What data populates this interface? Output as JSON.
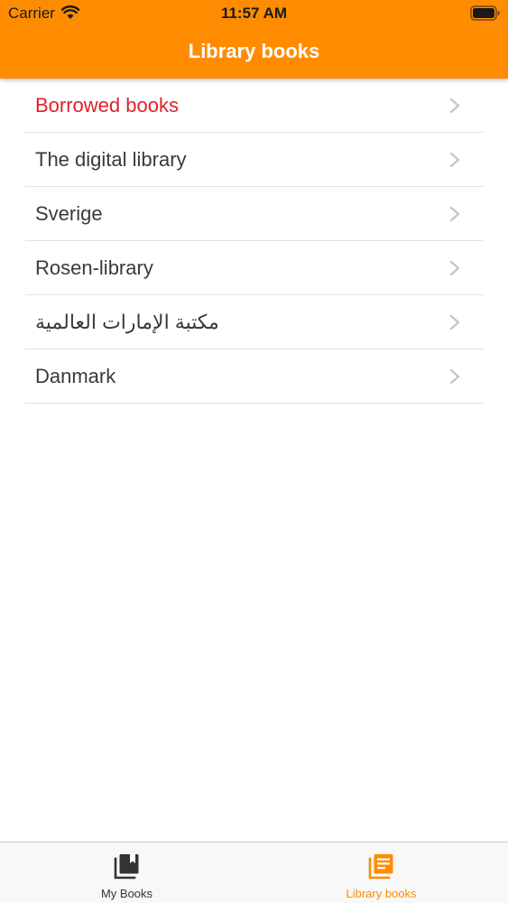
{
  "status_bar": {
    "carrier": "Carrier",
    "time": "11:57 AM"
  },
  "nav": {
    "title": "Library books"
  },
  "libraries": [
    {
      "label": "Borrowed books",
      "highlight": true
    },
    {
      "label": "The digital library"
    },
    {
      "label": "Sverige"
    },
    {
      "label": "Rosen-library"
    },
    {
      "label": "مكتبة الإمارات العالمية"
    },
    {
      "label": "Danmark"
    }
  ],
  "tab_bar": {
    "my_books_label": "My Books",
    "library_books_label": "Library books",
    "active_tab": "library_books"
  },
  "colors": {
    "accent": "#ff8c00",
    "highlight_text": "#e0202a"
  },
  "icons": {
    "status": [
      "wifi-icon",
      "battery-icon"
    ],
    "list": "chevron-right-icon",
    "tabs": [
      "books-stack-icon",
      "library-list-icon"
    ]
  }
}
